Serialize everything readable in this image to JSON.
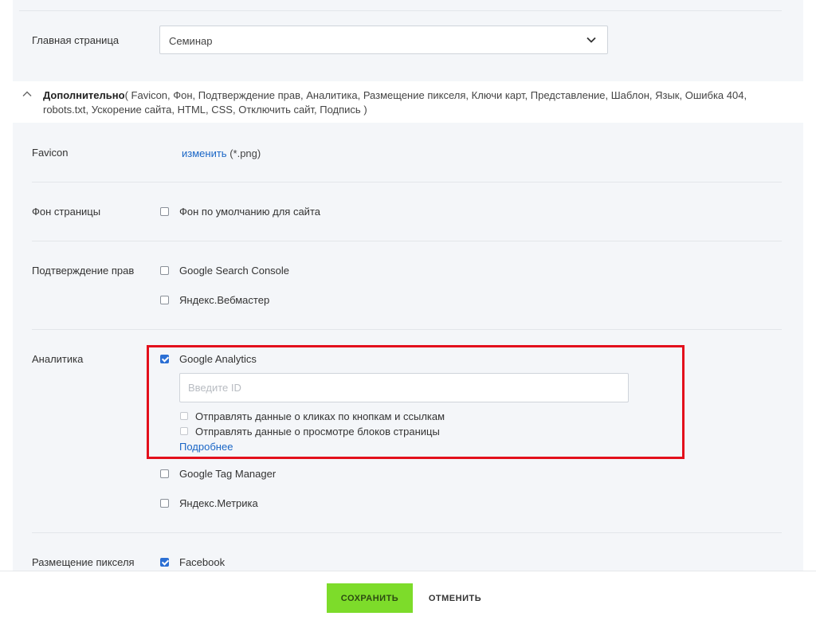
{
  "home": {
    "label": "Главная страница",
    "selected": "Семинар"
  },
  "additional": {
    "title": "Дополнительно",
    "list": "( Favicon,  Фон,  Подтверждение прав,  Аналитика,  Размещение пикселя,  Ключи карт,  Представление,  Шаблон,  Язык,  Ошибка 404,  robots.txt,  Ускорение сайта,  HTML,  CSS,  Отключить сайт,  Подпись )"
  },
  "favicon": {
    "label": "Favicon",
    "change_link": "изменить",
    "hint": "(*.png)"
  },
  "background": {
    "label": "Фон страницы",
    "option": "Фон по умолчанию для сайта"
  },
  "verification": {
    "label": "Подтверждение прав",
    "options": [
      "Google Search Console",
      "Яндекс.Вебмастер"
    ]
  },
  "analytics": {
    "label": "Аналитика",
    "ga": {
      "label": "Google Analytics",
      "checked": true,
      "input_placeholder": "Введите ID",
      "input_value": "",
      "sub_options": [
        "Отправлять данные о кликах по кнопкам и ссылкам",
        "Отправлять данные о просмотре блоков страницы"
      ],
      "more_link": "Подробнее"
    },
    "other_options": [
      "Google Tag Manager",
      "Яндекс.Метрика"
    ]
  },
  "pixel": {
    "label": "Размещение пикселя",
    "option": "Facebook",
    "checked": true
  },
  "footer": {
    "save": "СОХРАНИТЬ",
    "cancel": "ОТМЕНИТЬ"
  },
  "colors": {
    "accent_blue": "#2b6fd4",
    "link": "#1a66c6",
    "save_green": "#7ddc2a",
    "highlight_red": "#e3101c"
  }
}
